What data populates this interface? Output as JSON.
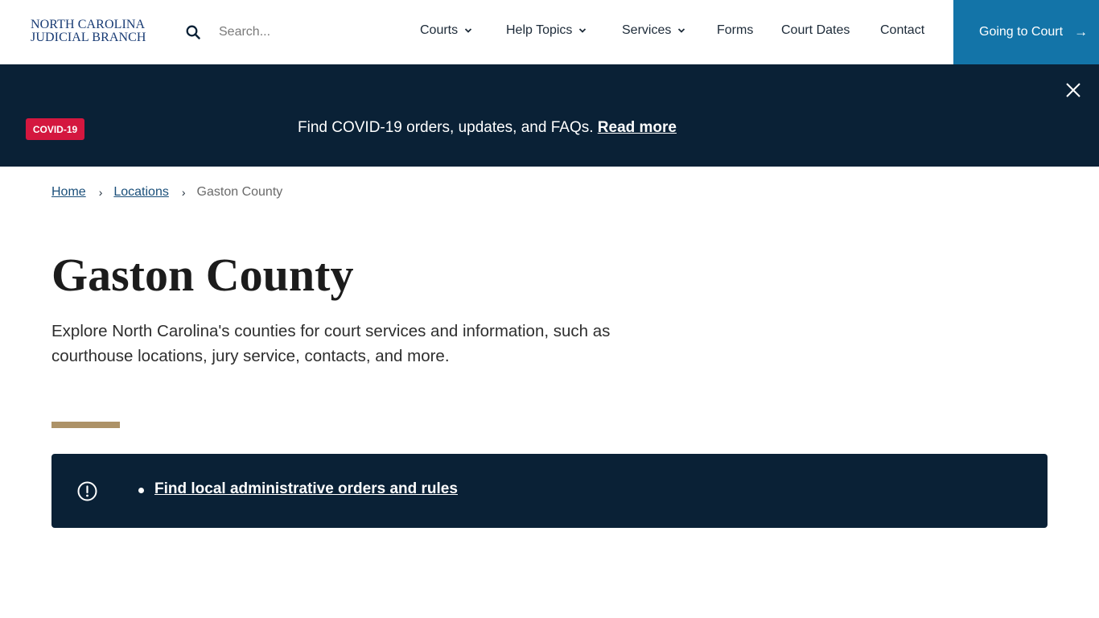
{
  "header": {
    "logo_line1": "NORTH CAROLINA",
    "logo_line2": "JUDICIAL BRANCH",
    "search": {
      "placeholder": "Search...",
      "value": "",
      "icon": "search-icon"
    },
    "nav": [
      {
        "label": "Courts",
        "has_dropdown": true
      },
      {
        "label": "Help Topics",
        "has_dropdown": true
      },
      {
        "label": "Services",
        "has_dropdown": true
      },
      {
        "label": "Forms",
        "has_dropdown": false
      },
      {
        "label": "Court Dates",
        "has_dropdown": false
      },
      {
        "label": "Contact",
        "has_dropdown": false
      }
    ],
    "cta": {
      "label": "Going to Court",
      "icon": "arrow-right-icon"
    }
  },
  "covid_banner": {
    "badge": "COVID-19",
    "text": "Find COVID-19 orders, updates, and FAQs.",
    "link_label": "Read more",
    "close_icon": "close-icon"
  },
  "breadcrumb": {
    "items": [
      {
        "label": "Home",
        "link": true
      },
      {
        "label": "Locations",
        "link": true
      },
      {
        "label": "Gaston County",
        "link": false
      }
    ],
    "separator_icon": "chevron-right-icon"
  },
  "page": {
    "title": "Gaston County",
    "intro": "Explore North Carolina's counties for court services and information, such as courthouse locations, jury service, contacts, and more."
  },
  "alert": {
    "icon": "exclamation-circle-icon",
    "links": [
      {
        "label": "Find local administrative orders and rules"
      }
    ]
  },
  "colors": {
    "brand_navy": "#0a2136",
    "cta_blue": "#1374a8",
    "covid_red": "#d4173f",
    "accent_gold": "#ad9267",
    "logo_blue": "#173a73"
  }
}
